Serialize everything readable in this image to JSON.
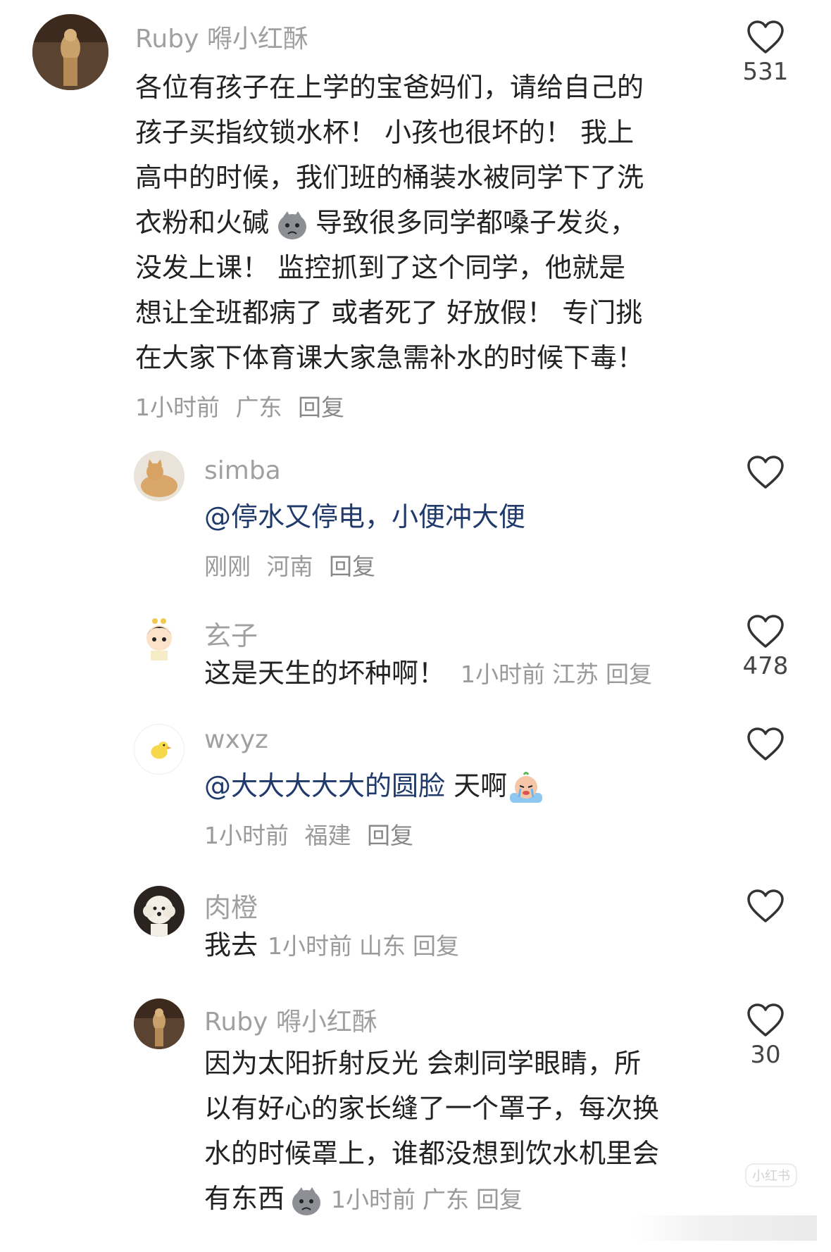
{
  "colors": {
    "name": "#a0a0a0",
    "body": "#222222",
    "meta": "#9a9a9a",
    "mention": "#1f3a6b",
    "like_count": "#444444"
  },
  "comments": [
    {
      "username": "Ruby 嘚小红酥",
      "lines": [
        "各位有孩子在上学的宝爸妈们，请给自己的",
        "孩子买指纹锁水杯！ 小孩也很坏的！ 我上",
        "高中的时候，我们班的桶装水被同学下了洗",
        "衣粉和火碱",
        "导致很多同学都嗓子发炎，",
        "没发上课！ 监控抓到了这个同学，他就是",
        "想让全班都病了 或者死了 好放假！ 专门挑",
        "在大家下体育课大家急需补水的时候下毒！"
      ],
      "time": "1小时前",
      "location": "广东",
      "reply": "回复",
      "likes": "531",
      "avatar_icon": "avatar-photo-icon"
    },
    {
      "username": "simba",
      "mention": "@停水又停电，小便冲大便",
      "time": "刚刚",
      "location": "河南",
      "reply": "回复",
      "likes": "",
      "avatar_icon": "cat-avatar-icon"
    },
    {
      "username": "玄子",
      "text": "这是天生的坏种啊！",
      "time": "1小时前",
      "location": "江苏",
      "reply": "回复",
      "likes": "478",
      "avatar_icon": "cartoon-boy-avatar-icon"
    },
    {
      "username": "wxyz",
      "mention": "@大大大大大的圆脸",
      "text": " 天啊",
      "time": "1小时前",
      "location": "福建",
      "reply": "回复",
      "likes": "",
      "avatar_icon": "chick-avatar-icon"
    },
    {
      "username": "肉橙",
      "text": "我去",
      "time": "1小时前",
      "location": "山东",
      "reply": "回复",
      "likes": "",
      "avatar_icon": "dog-avatar-icon"
    },
    {
      "username": "Ruby 嘚小红酥",
      "lines": [
        "因为太阳折射反光 会刺同学眼睛，所",
        "以有好心的家长缝了一个罩子，每次换",
        "水的时候罩上，谁都没想到饮水机里会",
        "有东西"
      ],
      "time": "1小时前",
      "location": "广东",
      "reply": "回复",
      "likes": "30",
      "avatar_icon": "avatar-photo-icon"
    }
  ],
  "watermark": "小红书"
}
